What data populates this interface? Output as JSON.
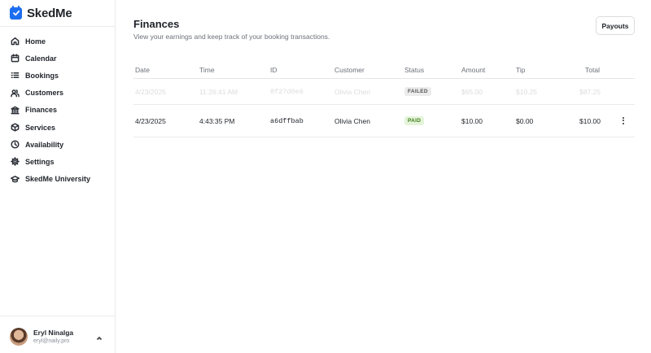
{
  "brand": {
    "name": "SkedMe"
  },
  "sidebar": {
    "items": [
      {
        "label": "Home",
        "icon": "home-icon"
      },
      {
        "label": "Calendar",
        "icon": "calendar-icon"
      },
      {
        "label": "Bookings",
        "icon": "list-icon"
      },
      {
        "label": "Customers",
        "icon": "users-icon"
      },
      {
        "label": "Finances",
        "icon": "bank-icon"
      },
      {
        "label": "Services",
        "icon": "box-icon"
      },
      {
        "label": "Availability",
        "icon": "clock-icon"
      },
      {
        "label": "Settings",
        "icon": "gear-icon"
      },
      {
        "label": "SkedMe University",
        "icon": "graduation-cap-icon"
      }
    ]
  },
  "user": {
    "name": "Eryl Ninalga",
    "email": "eryl@naily.pro"
  },
  "header": {
    "title": "Finances",
    "subtitle": "View your earnings and keep track of your booking transactions.",
    "payouts_label": "Payouts"
  },
  "table": {
    "columns": [
      "Date",
      "Time",
      "ID",
      "Customer",
      "Status",
      "Amount",
      "Tip",
      "Total"
    ],
    "rows": [
      {
        "date": "4/23/2025",
        "time": "11:26:41 AM",
        "id": "8f27d0e6",
        "customer": "Olivia Chen",
        "status": "FAILED",
        "amount": "$65.00",
        "tip": "$10.25",
        "total": "$87.25",
        "faded": true
      },
      {
        "date": "4/23/2025",
        "time": "4:43:35 PM",
        "id": "a6dffbab",
        "customer": "Olivia Chen",
        "status": "PAID",
        "amount": "$10.00",
        "tip": "$0.00",
        "total": "$10.00",
        "faded": false
      }
    ]
  },
  "colors": {
    "accent": "#1d6df0",
    "paid_bg": "#e4f4d9",
    "paid_text": "#3f7d1f",
    "failed_bg": "#ececec"
  }
}
